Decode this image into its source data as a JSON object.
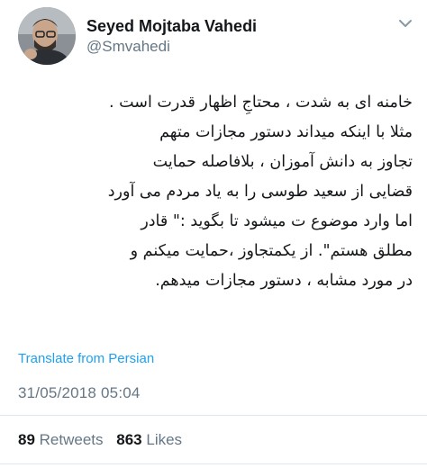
{
  "author": {
    "display_name": "Seyed Mojtaba Vahedi",
    "handle": "@Smvahedi",
    "avatar_icon": "profile-photo",
    "menu_icon": "chevron-down-icon"
  },
  "tweet": {
    "lines": [
      "خامنه ای به شدت ، محتاجِ اظهار قدرت است .",
      "مثلا با اینکه میداند  دستور مجازات متهم",
      "تجاوز به دانش آموزان ، بلافاصله حمایت",
      "قضایی از سعید طوسی را به یاد مردم می آورد",
      "اما وارد موضوع ت میشود تا بگوید :\" قادر",
      "مطلق هستم\". از یکمتجاوز ،حمایت میکنم و",
      "در مورد مشابه ، دستور مجازات میدهم."
    ]
  },
  "translate_link": "Translate from Persian",
  "timestamp": "31/05/2018 05:04",
  "stats": {
    "retweets_count": "89",
    "retweets_label": "Retweets",
    "likes_count": "863",
    "likes_label": "Likes"
  },
  "colors": {
    "link": "#1da1f2",
    "secondary_text": "#657786",
    "primary_text": "#14171a",
    "divider": "#e1e8ed"
  }
}
